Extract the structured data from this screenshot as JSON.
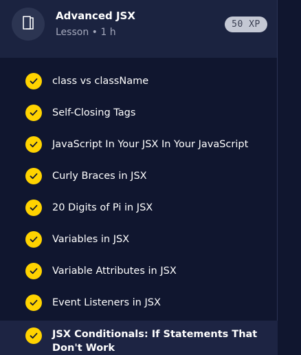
{
  "lesson": {
    "title": "Advanced JSX",
    "meta": "Lesson • 1 h",
    "xp": "50 XP",
    "icon": "book-icon"
  },
  "items": [
    {
      "label": "class vs className",
      "status": "completed"
    },
    {
      "label": "Self-Closing Tags",
      "status": "completed"
    },
    {
      "label": "JavaScript In Your JSX In Your JavaScript",
      "status": "completed"
    },
    {
      "label": "Curly Braces in JSX",
      "status": "completed"
    },
    {
      "label": "20 Digits of Pi in JSX",
      "status": "completed"
    },
    {
      "label": "Variables in JSX",
      "status": "completed"
    },
    {
      "label": "Variable Attributes in JSX",
      "status": "completed"
    },
    {
      "label": "Event Listeners in JSX",
      "status": "completed"
    },
    {
      "label": "JSX Conditionals: If Statements That Don't Work",
      "status": "completed",
      "active": true
    }
  ],
  "colors": {
    "background": "#10162f",
    "check": "#ffd300",
    "badge": "#c4c8d4"
  }
}
